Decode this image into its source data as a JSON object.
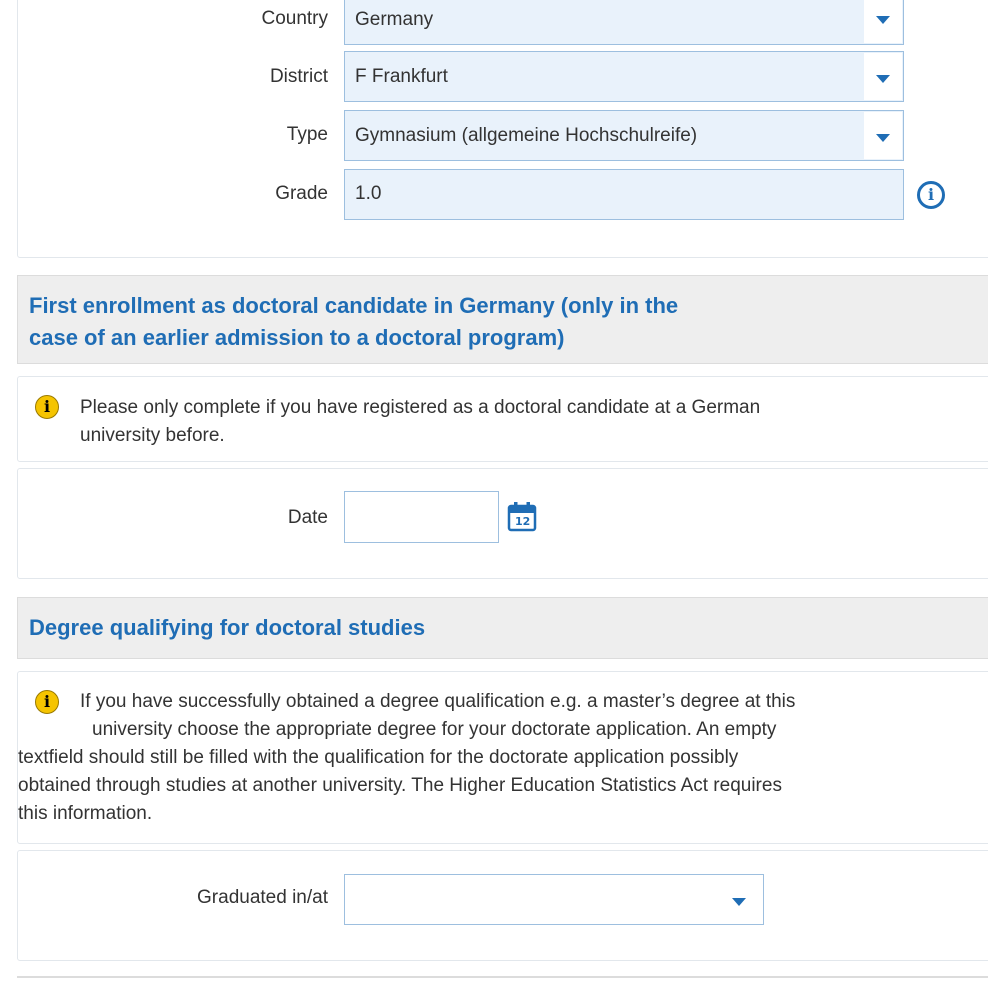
{
  "school_panel": {
    "country_label": "Country",
    "country_value": "Germany",
    "district_label": "District",
    "district_value": "F Frankfurt",
    "type_label": "Type",
    "type_value": "Gymnasium (allgemeine Hochschulreife)",
    "grade_label": "Grade",
    "grade_value": "1.0"
  },
  "first_enrollment": {
    "title": "First enrollment as doctoral candidate in Germany (only in the case of an earlier admission to a doctoral program)",
    "title_line1": "First enrollment as doctoral candidate in Germany (only in the",
    "title_line2": "case of an earlier admission to a doctoral program)",
    "info_line1": "Please only complete if you have registered as a doctoral candidate at a German",
    "info_line2": "university before.",
    "date_label": "Date",
    "date_value": "",
    "calendar_day": "12"
  },
  "degree_section": {
    "title": "Degree qualifying for doctoral studies",
    "info_line1": "If you have successfully obtained a degree qualification e.g. a master’s degree at this",
    "info_line2": "university choose the appropriate degree for your doctorate application. An empty",
    "info_line3": "textfield should still be filled with the qualification for the doctorate application possibly",
    "info_line4": "obtained through studies at another university. The Higher Education Statistics Act requires",
    "info_line5": "this information.",
    "graduated_label": "Graduated in/at",
    "graduated_value": ""
  },
  "icons": {
    "info_yellow": "i",
    "info_blue": "i"
  },
  "colors": {
    "accent": "#1f6db5",
    "field_bg": "#e9f2fb",
    "header_bg": "#eeeeee",
    "info_yellow": "#f5c400"
  }
}
